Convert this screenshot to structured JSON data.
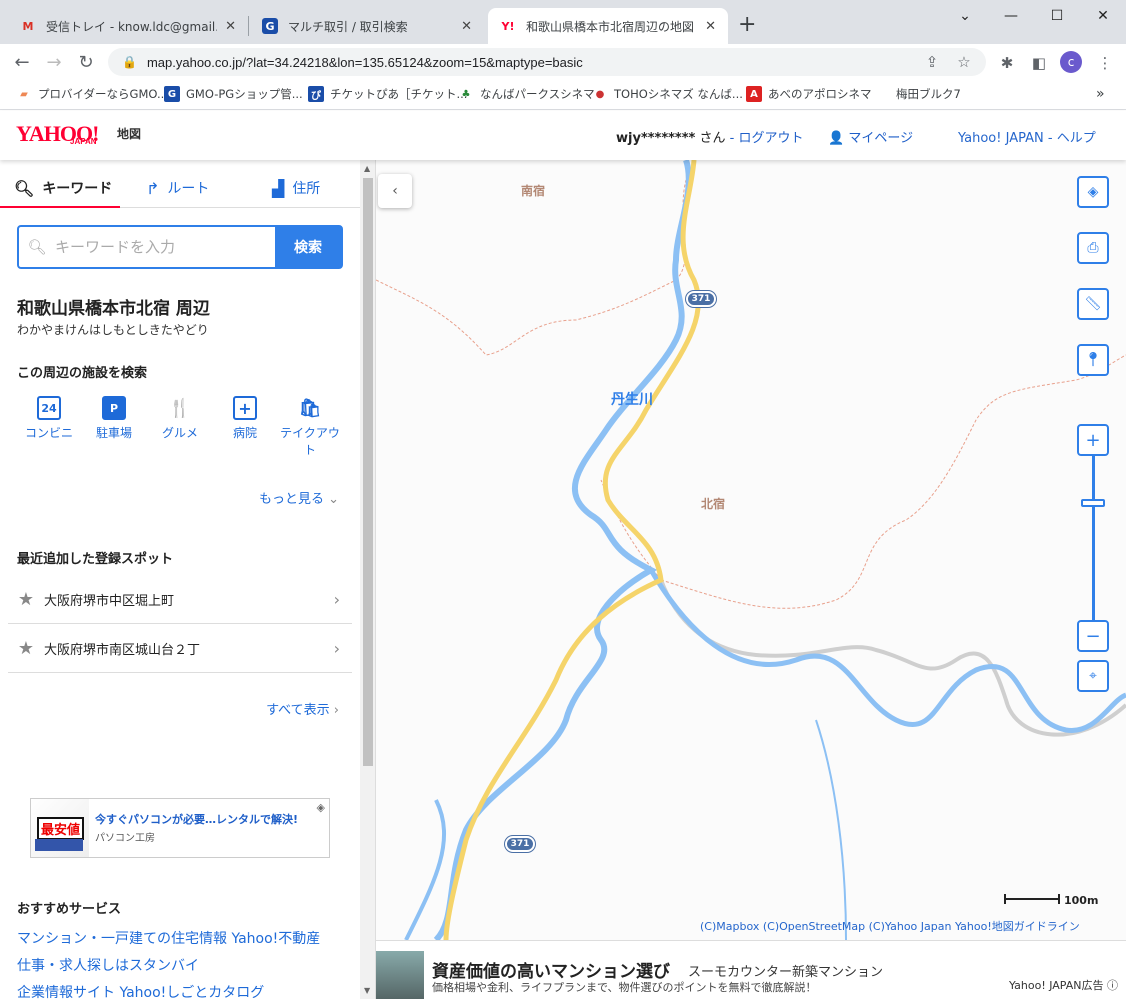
{
  "browser": {
    "tabs": [
      {
        "title": "受信トレイ - know.ldc@gmail.com",
        "favicon": "gmail-icon"
      },
      {
        "title": "マルチ取引 / 取引検索",
        "favicon": "gmo-icon"
      },
      {
        "title": "和歌山県橋本市北宿周辺の地図 -",
        "favicon": "yahoo-icon"
      }
    ],
    "url": "map.yahoo.co.jp/?lat=34.24218&lon=135.65124&zoom=15&maptype=basic",
    "profile_initial": "c",
    "bookmarks": [
      "プロバイダーならGMO...",
      "GMO-PGショップ管...",
      "チケットぴあ［チケット...",
      "なんばパークスシネマ",
      "TOHOシネマズ なんば...",
      "あべのアポロシネマ",
      "梅田ブルク7"
    ]
  },
  "header": {
    "logo": "YAHOO!",
    "logo_sub": "JAPAN",
    "service": "地図",
    "user_name": "wjy********",
    "user_suffix": "さん",
    "separator": "-",
    "logout": "ログアウト",
    "mypage": "マイページ",
    "yahoo_japan": "Yahoo! JAPAN",
    "help": "ヘルプ"
  },
  "sidebar": {
    "tabs": [
      "キーワード",
      "ルート",
      "住所"
    ],
    "search_placeholder": "キーワードを入力",
    "search_button": "検索",
    "location_title": "和歌山県橋本市北宿 周辺",
    "location_reading": "わかやまけんはしもとしきたやどり",
    "facility_heading": "この周辺の施設を検索",
    "facilities": [
      {
        "label": "コンビニ",
        "icon": "24"
      },
      {
        "label": "駐車場",
        "icon": "P"
      },
      {
        "label": "グルメ",
        "icon": "🍴"
      },
      {
        "label": "病院",
        "icon": "+"
      },
      {
        "label": "テイクアウト",
        "icon": "🛍"
      }
    ],
    "more": "もっと見る",
    "spots_heading": "最近追加した登録スポット",
    "spots": [
      "大阪府堺市中区堀上町",
      "大阪府堺市南区城山台２丁"
    ],
    "show_all": "すべて表示",
    "ad": {
      "title": "今すぐパソコンが必要…レンタルで解決!",
      "sponsor": "パソコン工房",
      "badge": "最安値"
    },
    "recommended_heading": "おすすめサービス",
    "recommended": [
      "マンション・一戸建ての住宅情報 Yahoo!不動産",
      "仕事・求人探しはスタンバイ",
      "企業情報サイト Yahoo!しごとカタログ"
    ]
  },
  "map": {
    "labels": {
      "minami": "南宿",
      "river": "丹生川",
      "kita": "北宿"
    },
    "route_number": "371",
    "scale": "100m",
    "credits": "(C)Mapbox  (C)OpenStreetMap  (C)Yahoo Japan  Yahoo!地図ガイドライン",
    "colors": {
      "water": "#8cc0f4",
      "road": "#f5d46a",
      "border": "#e8a08c",
      "label_place": "#b38874",
      "label_river": "#2f7fe8",
      "accent": "#2f7fe8"
    }
  },
  "bottom_ad": {
    "title": "資産価値の高いマンション選び",
    "sponsor": "スーモカウンター新築マンション",
    "desc": "価格相場や金利、ライフプランまで、物件選びのポイントを無料で徹底解説！",
    "label": "Yahoo! JAPAN広告"
  }
}
